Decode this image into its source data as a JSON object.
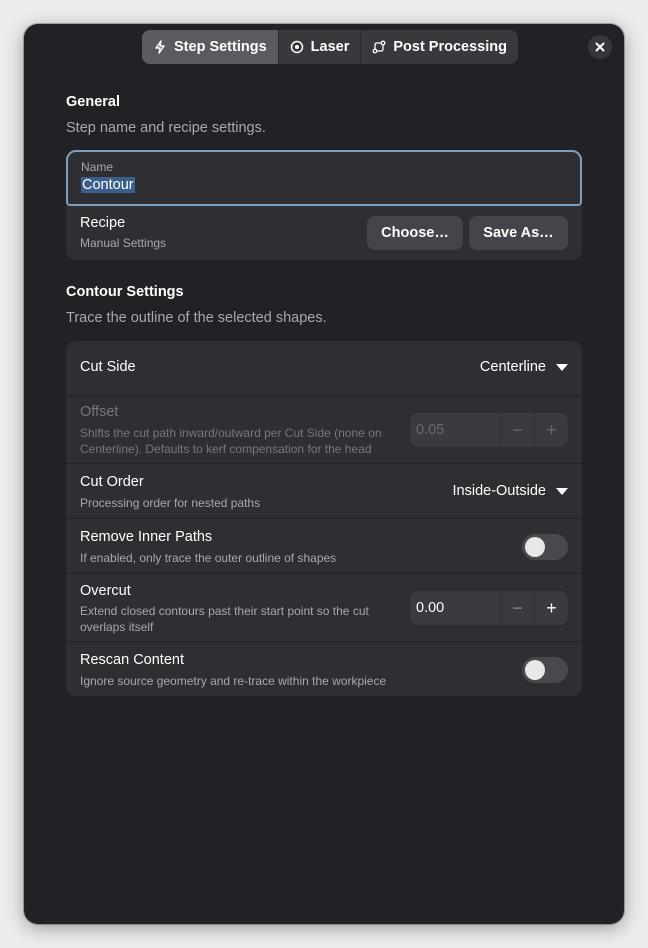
{
  "tabs": [
    {
      "label": "Step Settings",
      "icon": "lightning-icon",
      "active": true
    },
    {
      "label": "Laser",
      "icon": "target-icon",
      "active": false
    },
    {
      "label": "Post Processing",
      "icon": "workflow-icon",
      "active": false
    }
  ],
  "general": {
    "title": "General",
    "subtitle": "Step name and recipe settings.",
    "name_label": "Name",
    "name_value": "Contour",
    "recipe_title": "Recipe",
    "recipe_value": "Manual Settings",
    "choose_label": "Choose…",
    "save_as_label": "Save As…"
  },
  "contour": {
    "title": "Contour Settings",
    "subtitle": "Trace the outline of the selected shapes.",
    "cut_side": {
      "title": "Cut Side",
      "value": "Centerline"
    },
    "offset": {
      "title": "Offset",
      "sub1": "Shifts the cut path inward/outward per Cut Side (none on",
      "sub2": "Centerline). Defaults to kerf compensation for the head",
      "value": "0.05",
      "minus": "−",
      "plus": "+"
    },
    "cut_order": {
      "title": "Cut Order",
      "sub": "Processing order for nested paths",
      "value": "Inside-Outside"
    },
    "remove_inner": {
      "title": "Remove Inner Paths",
      "sub": "If enabled, only trace the outer outline of shapes",
      "enabled": false
    },
    "overcut": {
      "title": "Overcut",
      "sub1": "Extend closed contours past their start point so the cut",
      "sub2": "overlaps itself",
      "value": "0.00",
      "minus": "−",
      "plus": "+"
    },
    "rescan": {
      "title": "Rescan Content",
      "sub": "Ignore source geometry and re-trace within the workpiece",
      "enabled": false
    }
  },
  "colors": {
    "accent": "#7b9fc0",
    "selection": "#3b5f8d",
    "window_bg": "#222226",
    "card_bg": "#2e2e33"
  }
}
